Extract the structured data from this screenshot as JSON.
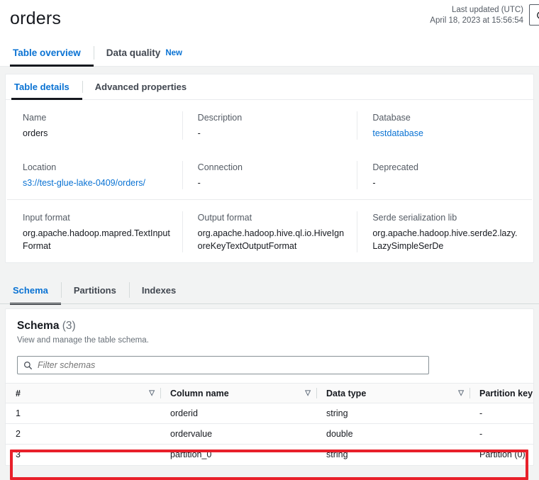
{
  "header": {
    "title": "orders",
    "last_updated_label": "Last updated (UTC)",
    "last_updated_value": "April 18, 2023 at 15:56:54",
    "refresh_icon": "refresh-icon"
  },
  "top_tabs": [
    {
      "label": "Table overview",
      "active": true,
      "badge": ""
    },
    {
      "label": "Data quality",
      "active": false,
      "badge": "New"
    }
  ],
  "inner_tabs": [
    {
      "label": "Table details",
      "active": true
    },
    {
      "label": "Advanced properties",
      "active": false
    }
  ],
  "details": [
    [
      {
        "label": "Name",
        "value": "orders",
        "link": false
      },
      {
        "label": "Description",
        "value": "-",
        "link": false
      },
      {
        "label": "Database",
        "value": "testdatabase",
        "link": true
      }
    ],
    [
      {
        "label": "Location",
        "value": "s3://test-glue-lake-0409/orders/",
        "link": true
      },
      {
        "label": "Connection",
        "value": "-",
        "link": false
      },
      {
        "label": "Deprecated",
        "value": "-",
        "link": false
      }
    ],
    [
      {
        "label": "Input format",
        "value": "org.apache.hadoop.mapred.TextInputFormat",
        "link": false
      },
      {
        "label": "Output format",
        "value": "org.apache.hadoop.hive.ql.io.HiveIgnoreKeyTextOutputFormat",
        "link": false
      },
      {
        "label": "Serde serialization lib",
        "value": "org.apache.hadoop.hive.serde2.lazy.LazySimpleSerDe",
        "link": false
      }
    ]
  ],
  "schema_tabs": [
    {
      "label": "Schema",
      "active": true
    },
    {
      "label": "Partitions",
      "active": false
    },
    {
      "label": "Indexes",
      "active": false
    }
  ],
  "schema": {
    "title": "Schema",
    "count": "(3)",
    "subtitle": "View and manage the table schema.",
    "filter_placeholder": "Filter schemas",
    "filter_value": "",
    "search_icon": "search-icon",
    "sort_icon": "sort-descending-icon",
    "columns": [
      "#",
      "Column name",
      "Data type",
      "Partition key"
    ],
    "rows": [
      {
        "num": "1",
        "name": "orderid",
        "type": "string",
        "partition": "-"
      },
      {
        "num": "2",
        "name": "ordervalue",
        "type": "double",
        "partition": "-"
      },
      {
        "num": "3",
        "name": "partition_0",
        "type": "string",
        "partition": "Partition (0)"
      }
    ]
  },
  "annotation": {
    "color": "#e8202a",
    "target": "schema-row-3"
  },
  "colors": {
    "accent_blue": "#0972d3",
    "page_background": "#f2f3f3",
    "card_background": "#ffffff",
    "annotation_red": "#e8202a"
  }
}
